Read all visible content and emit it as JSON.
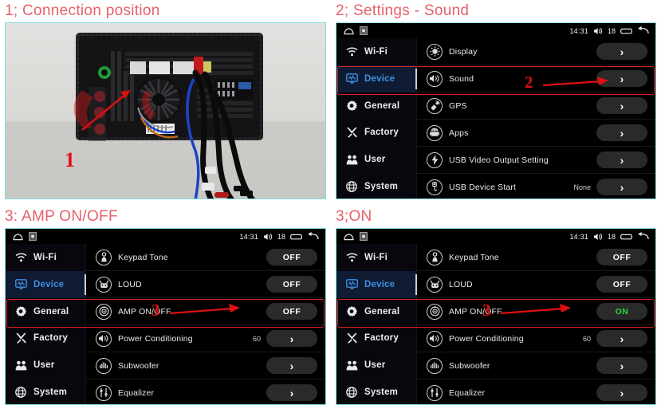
{
  "panels": {
    "connection": {
      "caption": "1; Connection position",
      "annotation": {
        "step": "1"
      }
    },
    "settings_sound": {
      "caption": "2; Settings - Sound",
      "annotation": {
        "step": "2"
      },
      "statusbar": {
        "time": "14:31",
        "volume": "18"
      },
      "nav": [
        {
          "label": "Wi-Fi",
          "icon": "wifi-icon",
          "active": false
        },
        {
          "label": "Device",
          "icon": "device-icon",
          "active": true
        },
        {
          "label": "General",
          "icon": "gear-icon",
          "active": false
        },
        {
          "label": "Factory",
          "icon": "tools-icon",
          "active": false
        },
        {
          "label": "User",
          "icon": "user-icon",
          "active": false
        },
        {
          "label": "System",
          "icon": "globe-icon",
          "active": false
        }
      ],
      "rows": [
        {
          "label": "Display",
          "icon": "brightness-icon",
          "value": "",
          "control": "chevron",
          "highlight": false
        },
        {
          "label": "Sound",
          "icon": "speaker-icon",
          "value": "",
          "control": "chevron",
          "highlight": true
        },
        {
          "label": "GPS",
          "icon": "satellite-icon",
          "value": "",
          "control": "chevron",
          "highlight": false
        },
        {
          "label": "Apps",
          "icon": "android-icon",
          "value": "",
          "control": "chevron",
          "highlight": false
        },
        {
          "label": "USB Video Output Setting",
          "icon": "bolt-icon",
          "value": "",
          "control": "chevron",
          "highlight": false
        },
        {
          "label": "USB Device Start",
          "icon": "usb-icon",
          "value": "None",
          "control": "chevron",
          "highlight": false
        }
      ]
    },
    "amp_off": {
      "caption": "3: AMP ON/OFF",
      "annotation": {
        "step": "3"
      },
      "statusbar": {
        "time": "14:31",
        "volume": "18"
      },
      "nav": [
        {
          "label": "Wi-Fi",
          "icon": "wifi-icon",
          "active": false
        },
        {
          "label": "Device",
          "icon": "device-icon",
          "active": true
        },
        {
          "label": "General",
          "icon": "gear-icon",
          "active": false
        },
        {
          "label": "Factory",
          "icon": "tools-icon",
          "active": false
        },
        {
          "label": "User",
          "icon": "user-icon",
          "active": false
        },
        {
          "label": "System",
          "icon": "globe-icon",
          "active": false
        }
      ],
      "rows": [
        {
          "label": "Keypad Tone",
          "icon": "keypad-tone-icon",
          "value": "",
          "control": "OFF",
          "highlight": false
        },
        {
          "label": "LOUD",
          "icon": "loud-icon",
          "value": "",
          "control": "OFF",
          "highlight": false
        },
        {
          "label": "AMP ON/OFF",
          "icon": "amp-icon",
          "value": "",
          "control": "OFF",
          "highlight": true
        },
        {
          "label": "Power Conditioning",
          "icon": "speaker-icon",
          "value": "60",
          "control": "chevron",
          "highlight": false
        },
        {
          "label": "Subwoofer",
          "icon": "subwoofer-icon",
          "value": "",
          "control": "chevron",
          "highlight": false
        },
        {
          "label": "Equalizer",
          "icon": "equalizer-icon",
          "value": "",
          "control": "chevron",
          "highlight": false
        }
      ]
    },
    "amp_on": {
      "caption": "3;ON",
      "annotation": {
        "step": "3"
      },
      "statusbar": {
        "time": "14:31",
        "volume": "18"
      },
      "nav": [
        {
          "label": "Wi-Fi",
          "icon": "wifi-icon",
          "active": false
        },
        {
          "label": "Device",
          "icon": "device-icon",
          "active": true
        },
        {
          "label": "General",
          "icon": "gear-icon",
          "active": false
        },
        {
          "label": "Factory",
          "icon": "tools-icon",
          "active": false
        },
        {
          "label": "User",
          "icon": "user-icon",
          "active": false
        },
        {
          "label": "System",
          "icon": "globe-icon",
          "active": false
        }
      ],
      "rows": [
        {
          "label": "Keypad Tone",
          "icon": "keypad-tone-icon",
          "value": "",
          "control": "OFF",
          "highlight": false
        },
        {
          "label": "LOUD",
          "icon": "loud-icon",
          "value": "",
          "control": "OFF",
          "highlight": false
        },
        {
          "label": "AMP ON/OFF",
          "icon": "amp-icon",
          "value": "",
          "control": "ON",
          "highlight": true
        },
        {
          "label": "Power Conditioning",
          "icon": "speaker-icon",
          "value": "60",
          "control": "chevron",
          "highlight": false
        },
        {
          "label": "Subwoofer",
          "icon": "subwoofer-icon",
          "value": "",
          "control": "chevron",
          "highlight": false
        },
        {
          "label": "Equalizer",
          "icon": "equalizer-icon",
          "value": "",
          "control": "chevron",
          "highlight": false
        }
      ]
    }
  },
  "colors": {
    "caption_red": "#e8606a",
    "annotation_red": "#e01010",
    "accent_blue": "#3f8fe0",
    "on_green": "#2fd43a",
    "panel_border": "#7fdfe0"
  }
}
